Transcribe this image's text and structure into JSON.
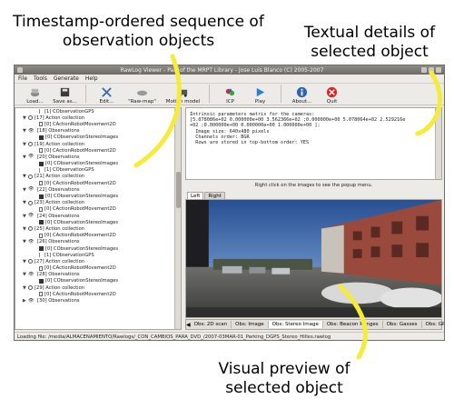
{
  "annotations": {
    "left": [
      "Timestamp-ordered sequence of",
      "observation objects"
    ],
    "right": [
      "Textual details of",
      "selected object"
    ],
    "bottom": [
      "Visual preview of",
      "selected object"
    ]
  },
  "window": {
    "title": "RawLog Viewer - Part of the MRPT Library - Jose Luis Blanco (C) 2005-2007"
  },
  "menu": [
    "File",
    "Tools",
    "Generate",
    "Help"
  ],
  "toolbar": [
    {
      "label": "Load...",
      "icon": "load-icon"
    },
    {
      "label": "Save as...",
      "icon": "save-icon"
    },
    {
      "label": "Edit...",
      "icon": "edit-icon"
    },
    {
      "label": "\"Raw-map\"",
      "icon": "raw-map-icon"
    },
    {
      "label": "Motion model",
      "icon": "motion-model-icon"
    },
    {
      "label": "ICP",
      "icon": "icp-icon"
    },
    {
      "label": "Play",
      "icon": "play-icon"
    },
    {
      "label": "About...",
      "icon": "about-icon"
    },
    {
      "label": "Quit",
      "icon": "quit-icon"
    }
  ],
  "tree": [
    {
      "text": "[1] CObservationGPS",
      "icon": "gps",
      "indent": 3,
      "exp": ""
    },
    {
      "text": "[17] Action collection",
      "icon": "gear",
      "indent": 1,
      "exp": "▼"
    },
    {
      "text": "[0] CActionRobotMovement2D",
      "icon": "doc",
      "indent": 3,
      "exp": ""
    },
    {
      "text": "[18] Observations",
      "icon": "eyes",
      "indent": 1,
      "exp": "▼"
    },
    {
      "text": "[0] CObservationStereoImages",
      "icon": "stereo",
      "indent": 3,
      "exp": ""
    },
    {
      "text": "[19] Action collection",
      "icon": "gear",
      "indent": 1,
      "exp": "▼"
    },
    {
      "text": "[0] CActionRobotMovement2D",
      "icon": "doc",
      "indent": 3,
      "exp": ""
    },
    {
      "text": "[20] Observations",
      "icon": "eyes",
      "indent": 1,
      "exp": "▼"
    },
    {
      "text": "[0] CObservationStereoImages",
      "icon": "stereo",
      "indent": 3,
      "exp": ""
    },
    {
      "text": "[1] CObservationGPS",
      "icon": "gps",
      "indent": 3,
      "exp": ""
    },
    {
      "text": "[21] Action collection",
      "icon": "gear",
      "indent": 1,
      "exp": "▼"
    },
    {
      "text": "[0] CActionRobotMovement2D",
      "icon": "doc",
      "indent": 3,
      "exp": ""
    },
    {
      "text": "[22] Observations",
      "icon": "eyes",
      "indent": 1,
      "exp": "▼"
    },
    {
      "text": "[0] CObservationStereoImages",
      "icon": "stereo",
      "indent": 3,
      "exp": ""
    },
    {
      "text": "[23] Action collection",
      "icon": "gear",
      "indent": 1,
      "exp": "▼"
    },
    {
      "text": "[0] CActionRobotMovement2D",
      "icon": "doc",
      "indent": 3,
      "exp": ""
    },
    {
      "text": "[24] Observations",
      "icon": "eyes",
      "indent": 1,
      "exp": "▼"
    },
    {
      "text": "[0] CObservationStereoImages",
      "icon": "stereo",
      "indent": 3,
      "exp": ""
    },
    {
      "text": "[25] Action collection",
      "icon": "gear",
      "indent": 1,
      "exp": "▼"
    },
    {
      "text": "[0] CActionRobotMovement2D",
      "icon": "doc",
      "indent": 3,
      "exp": ""
    },
    {
      "text": "[26] Observations",
      "icon": "eyes",
      "indent": 1,
      "exp": "▼"
    },
    {
      "text": "[0] CObservationStereoImages",
      "icon": "stereo",
      "indent": 3,
      "exp": ""
    },
    {
      "text": "[1] CObservationGPS",
      "icon": "gps",
      "indent": 3,
      "exp": ""
    },
    {
      "text": "[27] Action collection",
      "icon": "gear",
      "indent": 1,
      "exp": "▼"
    },
    {
      "text": "[0] CActionRobotMovement2D",
      "icon": "doc",
      "indent": 3,
      "exp": ""
    },
    {
      "text": "[28] Observations",
      "icon": "eyes",
      "indent": 1,
      "exp": "▼"
    },
    {
      "text": "[0] CObservationStereoImages",
      "icon": "stereo",
      "indent": 3,
      "exp": ""
    },
    {
      "text": "[29] Action collection",
      "icon": "gear",
      "indent": 1,
      "exp": "▼"
    },
    {
      "text": "[0] CActionRobotMovement2D",
      "icon": "doc",
      "indent": 3,
      "exp": ""
    },
    {
      "text": "[30] Observations",
      "icon": "eyes",
      "indent": 1,
      "exp": "▶"
    }
  ],
  "details": [
    "Intrinsic parameters matrix for the cameras:",
    "[5.078086e+02 0.000000e+00 3.562366e+02 ;0.000000e+00 5.078064e+02 2.529216e",
    "+02 ;0.000000e+00 0.000000e+00 1.000000e+00 ];",
    "  Image size: 640x480 pixels",
    "  Channels order: BGR",
    "  Rows are stored in top-bottom order: YES"
  ],
  "preview": {
    "hint": "Right click on the images to see the popup menu.",
    "lr_tabs": [
      "Left",
      "Right"
    ],
    "active_lr_tab": "Left"
  },
  "bottom_tabs": [
    "Obs: 2D scan",
    "Obs: Image",
    "Obs: Stereo Image",
    "Obs: Beacon Ranges",
    "Obs: Gasses",
    "Obs: GPS"
  ],
  "active_bottom_tab": "Obs: Stereo Image",
  "status": "Loading file: /media/ALMACENAMIENTO/Rawlogs/_CON_CAMBIOS_PARA_DVD_/2007-03MAR-01_Parking_DGPS_Stereo_Hilles.rawlog",
  "colors": {
    "arrow": "#f5eb3a",
    "sky_top": "#3e6fb8",
    "building": "#9a4a3c"
  }
}
